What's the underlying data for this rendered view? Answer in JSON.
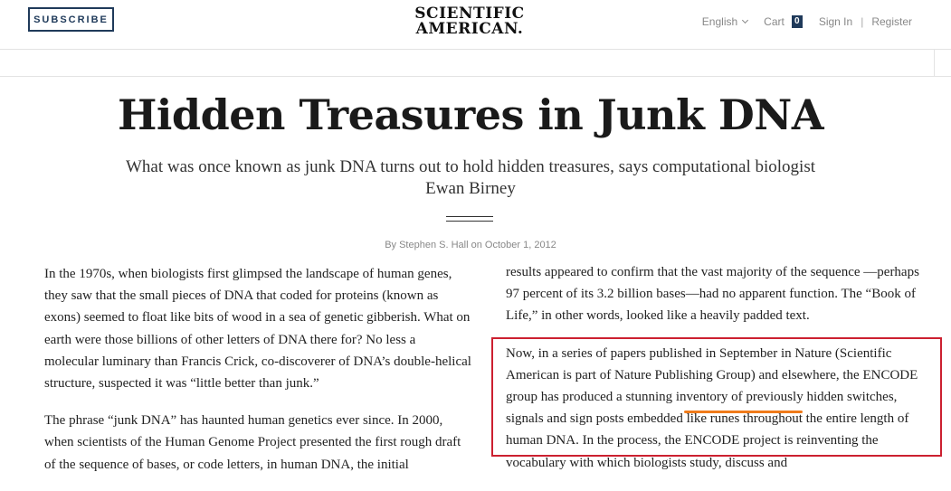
{
  "header": {
    "subscribe_label": "SUBSCRIBE",
    "logo_line1": "SCIENTIFIC",
    "logo_line2": "AMERICAN.",
    "nav": {
      "language": "English",
      "cart_label": "Cart",
      "cart_count": "0",
      "sign_in": "Sign In",
      "separator": "|",
      "register": "Register"
    }
  },
  "article": {
    "title": "Hidden Treasures in Junk DNA",
    "subtitle": "What was once known as junk DNA turns out to hold hidden treasures, says computational biologist Ewan Birney",
    "byline_prefix": "By",
    "author": "Stephen S. Hall",
    "byline_on": "on",
    "date": "October 1, 2012",
    "left_paragraphs": [
      "In the 1970s, when biologists first glimpsed the landscape of human genes, they saw that the small pieces of DNA that coded for proteins (known as exons) seemed to float like bits of wood in a sea of genetic gibberish. What on earth were those billions of other letters of DNA there for? No less a molecular luminary than Francis Crick, co-discoverer of DNA’s double-helical structure, suspected it was “little better than junk.”",
      "The phrase “junk DNA” has haunted human genetics ever since. In 2000, when scientists of the Human Genome Project presented the first rough draft of the sequence of bases, or code letters, in human DNA, the initial"
    ],
    "right_paragraphs": [
      "results appeared to confirm that the vast majority of the sequence —perhaps 97 percent of its 3.2 billion bases—had no apparent function. The “Book of Life,” in other words, looked like a heavily padded text.",
      "Now, in a series of papers published in September in Nature (Scientific American is part of Nature Publishing Group) and elsewhere, the ENCODE group has produced a stunning inventory of previously hidden switches, signals and sign posts embedded like runes throughout the entire length of human DNA. In the process, the ENCODE project is reinventing the vocabulary with which biologists study, discuss and"
    ]
  },
  "colors": {
    "brand_navy": "#1f3a5a",
    "highlight_box": "#cc2030",
    "underline_mark": "#f07b1a"
  }
}
